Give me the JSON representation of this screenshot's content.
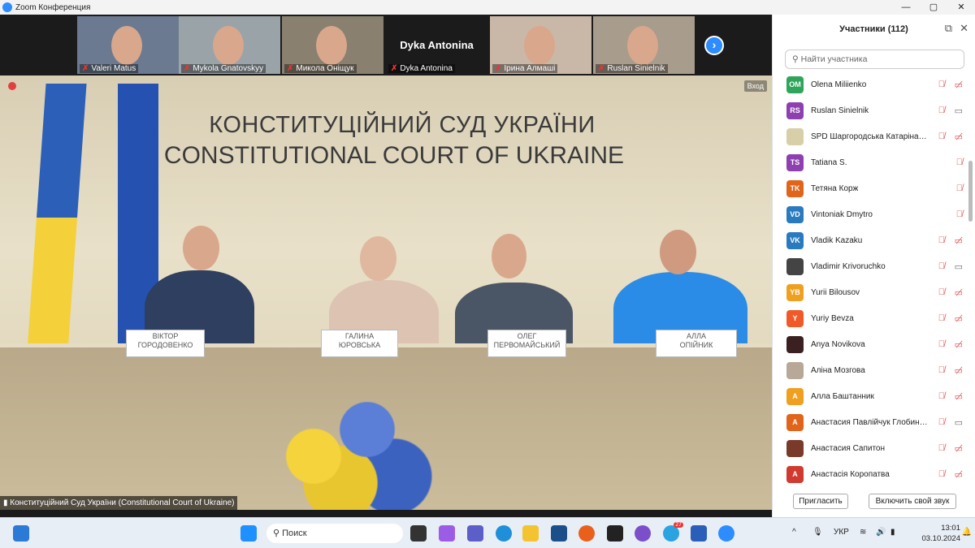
{
  "window": {
    "title": "Zoom Конференция",
    "controls": [
      "—",
      "▢",
      "✕"
    ]
  },
  "gallery": {
    "tiles": [
      {
        "name": "Valeri Matus",
        "bg": "#6b7a90"
      },
      {
        "name": "Mykola Gnatovskyy",
        "bg": "#9aa3a8"
      },
      {
        "name": "Микола Оніщук",
        "bg": "#8a8070"
      },
      {
        "name": "Dyka Antonina",
        "bg": "#1b1b1b",
        "big": "Dyka Antonina"
      },
      {
        "name": "Ірина Алмаші",
        "bg": "#c9b8a8"
      },
      {
        "name": "Ruslan Sinielnik",
        "bg": "#a89c8c"
      }
    ],
    "next": "›"
  },
  "video": {
    "wall_ua": "КОНСТИТУЦІЙНИЙ СУД УКРАЇНИ",
    "wall_en": "CONSTITUTIONAL COURT OF UKRAINE",
    "plates": [
      [
        "ВІКТОР",
        "ГОРОДОВЕНКО"
      ],
      [
        "ГАЛИНА",
        "ЮРОВСЬКА"
      ],
      [
        "ОЛЕГ",
        "ПЕРВОМАЙСЬКИЙ"
      ],
      [
        "АЛЛА",
        "ОПІЙНИК"
      ]
    ],
    "entry": "Вход",
    "caption": "Конституційний Суд України (Constitutional Court of Ukraine)"
  },
  "panel": {
    "title": "Участники (112)",
    "search_placeholder": "Найти участника",
    "participants": [
      {
        "initials": "OM",
        "name": "Olena Miliienko",
        "color": "#2fa55a",
        "cam": "off"
      },
      {
        "initials": "RS",
        "name": "Ruslan Sinielnik",
        "color": "#8e3fb0",
        "cam": "on"
      },
      {
        "initials": "",
        "name": "SPD Шаргородська Катаріна М...",
        "color": "#d8cfa8",
        "cam": "off"
      },
      {
        "initials": "TS",
        "name": "Tatiana S.",
        "color": "#8e3fb0",
        "cam": "none"
      },
      {
        "initials": "TK",
        "name": "Тетяна Корж",
        "color": "#e0651a",
        "cam": "none"
      },
      {
        "initials": "VD",
        "name": "Vintoniak Dmytro",
        "color": "#2a7ac0",
        "cam": "none"
      },
      {
        "initials": "VK",
        "name": "Vladik Kazaku",
        "color": "#2a7ac0",
        "cam": "off"
      },
      {
        "initials": "",
        "name": "Vladimir Krivoruchko",
        "color": "#444",
        "cam": "on"
      },
      {
        "initials": "YB",
        "name": "Yurii Bilousov",
        "color": "#f0a020",
        "cam": "off"
      },
      {
        "initials": "Y",
        "name": "Yuriy Bevza",
        "color": "#f05a28",
        "cam": "off"
      },
      {
        "initials": "",
        "name": "Anya Novikova",
        "color": "#3a2020",
        "cam": "off"
      },
      {
        "initials": "",
        "name": "Аліна Мозгова",
        "color": "#b8a898",
        "cam": "off"
      },
      {
        "initials": "A",
        "name": "Алла Баштанник",
        "color": "#f0a020",
        "cam": "off"
      },
      {
        "initials": "A",
        "name": "Анастасия Павлійчук Глобинсь...",
        "color": "#e0651a",
        "cam": "on"
      },
      {
        "initials": "",
        "name": "Анастасия Сапитон",
        "color": "#7a3a2a",
        "cam": "off"
      },
      {
        "initials": "A",
        "name": "Анастасія Коропатва",
        "color": "#d03a30",
        "cam": "off"
      }
    ],
    "invite": "Пригласить",
    "unmute": "Включить свой звук"
  },
  "taskbar": {
    "search": "Поиск",
    "lang": "УКР",
    "time": "13:01",
    "date": "03.10.2024",
    "telegram_badge": "27"
  }
}
